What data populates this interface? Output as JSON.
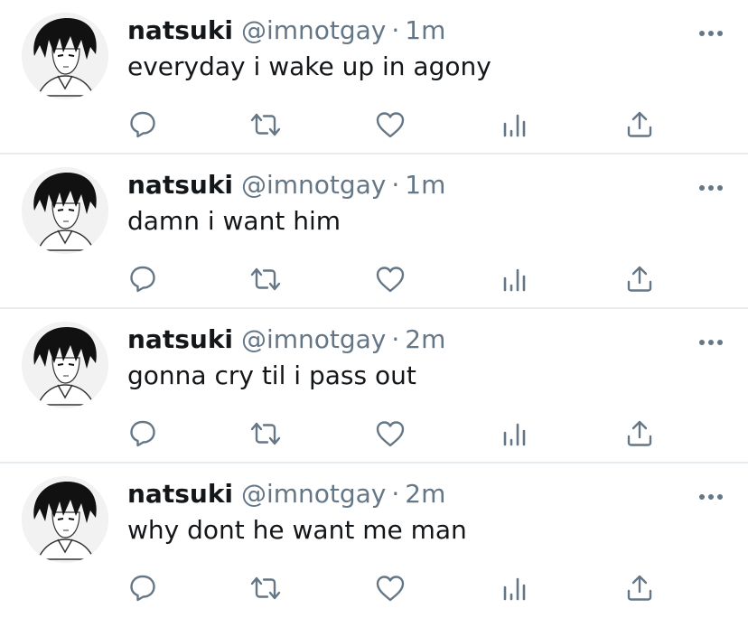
{
  "author": {
    "display_name": "natsuki",
    "handle": "@imnotgay",
    "separator": "·"
  },
  "tweets": [
    {
      "time": "1m",
      "text": "everyday i wake up in agony"
    },
    {
      "time": "1m",
      "text": "damn i want him"
    },
    {
      "time": "2m",
      "text": "gonna cry til i pass out"
    },
    {
      "time": "2m",
      "text": "why dont he want me man"
    }
  ],
  "icons": {
    "reply": "reply-icon",
    "retweet": "retweet-icon",
    "like": "heart-icon",
    "analytics": "analytics-icon",
    "share": "share-icon",
    "more": "more-icon"
  },
  "colors": {
    "icon": "#657786",
    "text": "#14171a",
    "divider": "#e6ecf0"
  }
}
